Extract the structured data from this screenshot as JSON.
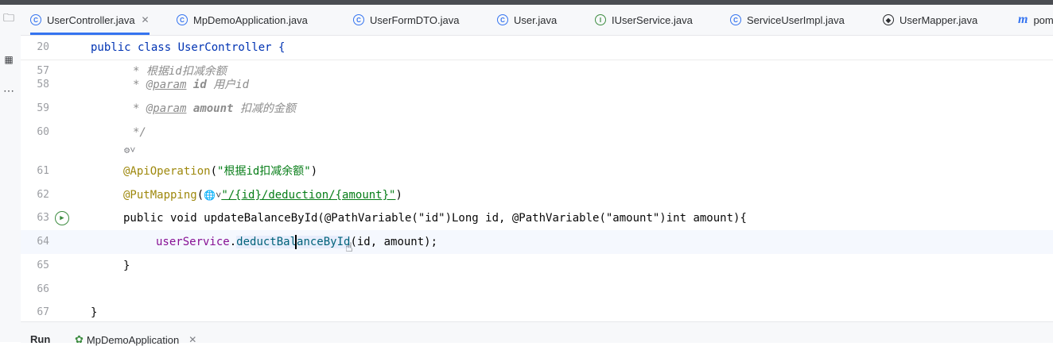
{
  "tabs": [
    {
      "label": "UserController.java",
      "icon": "class-icon",
      "active": true,
      "closable": true
    },
    {
      "label": "MpDemoApplication.java",
      "icon": "spring-class-icon"
    },
    {
      "label": "UserFormDTO.java",
      "icon": "class-icon"
    },
    {
      "label": "User.java",
      "icon": "class-icon"
    },
    {
      "label": "IUserService.java",
      "icon": "interface-icon"
    },
    {
      "label": "ServiceUserImpl.java",
      "icon": "class-icon"
    },
    {
      "label": "UserMapper.java",
      "icon": "mapper-icon"
    },
    {
      "label": "pom",
      "icon": "maven-icon"
    }
  ],
  "editor": {
    "sticky_line": {
      "number": "20",
      "text": "public class UserController {"
    },
    "lines": [
      {
        "number": "57",
        "text": "* 根据id扣减余额"
      },
      {
        "number": "58",
        "star": "*",
        "tag": "@param",
        "name": "id",
        "desc": "用户id"
      },
      {
        "number": "59",
        "star": "*",
        "tag": "@param",
        "name": "amount",
        "desc": "扣减的金额"
      },
      {
        "number": "60",
        "text": "*/"
      },
      {
        "number": "61",
        "annotation": "@ApiOperation",
        "arg": "\"根据id扣减余额\""
      },
      {
        "number": "62",
        "annotation": "@PutMapping",
        "arg": "\"/{id}/deduction/{amount}\""
      },
      {
        "number": "63",
        "text": "public void updateBalanceById(@PathVariable(\"id\")Long id, @PathVariable(\"amount\")int amount){"
      },
      {
        "number": "64",
        "field": "userService",
        "method": "deductBalanceById",
        "args": "(id, amount);"
      },
      {
        "number": "65",
        "text": "}"
      },
      {
        "number": "66",
        "text": ""
      },
      {
        "number": "67",
        "text": "}"
      }
    ],
    "current_line": "64"
  },
  "run_bar": {
    "label": "Run",
    "config": "MpDemoApplication"
  },
  "colors": {
    "accent": "#3574f0",
    "keyword": "#0033b3",
    "annotation": "#9e880d",
    "string": "#067d17",
    "field": "#871094",
    "comment": "#8c8c8c"
  }
}
